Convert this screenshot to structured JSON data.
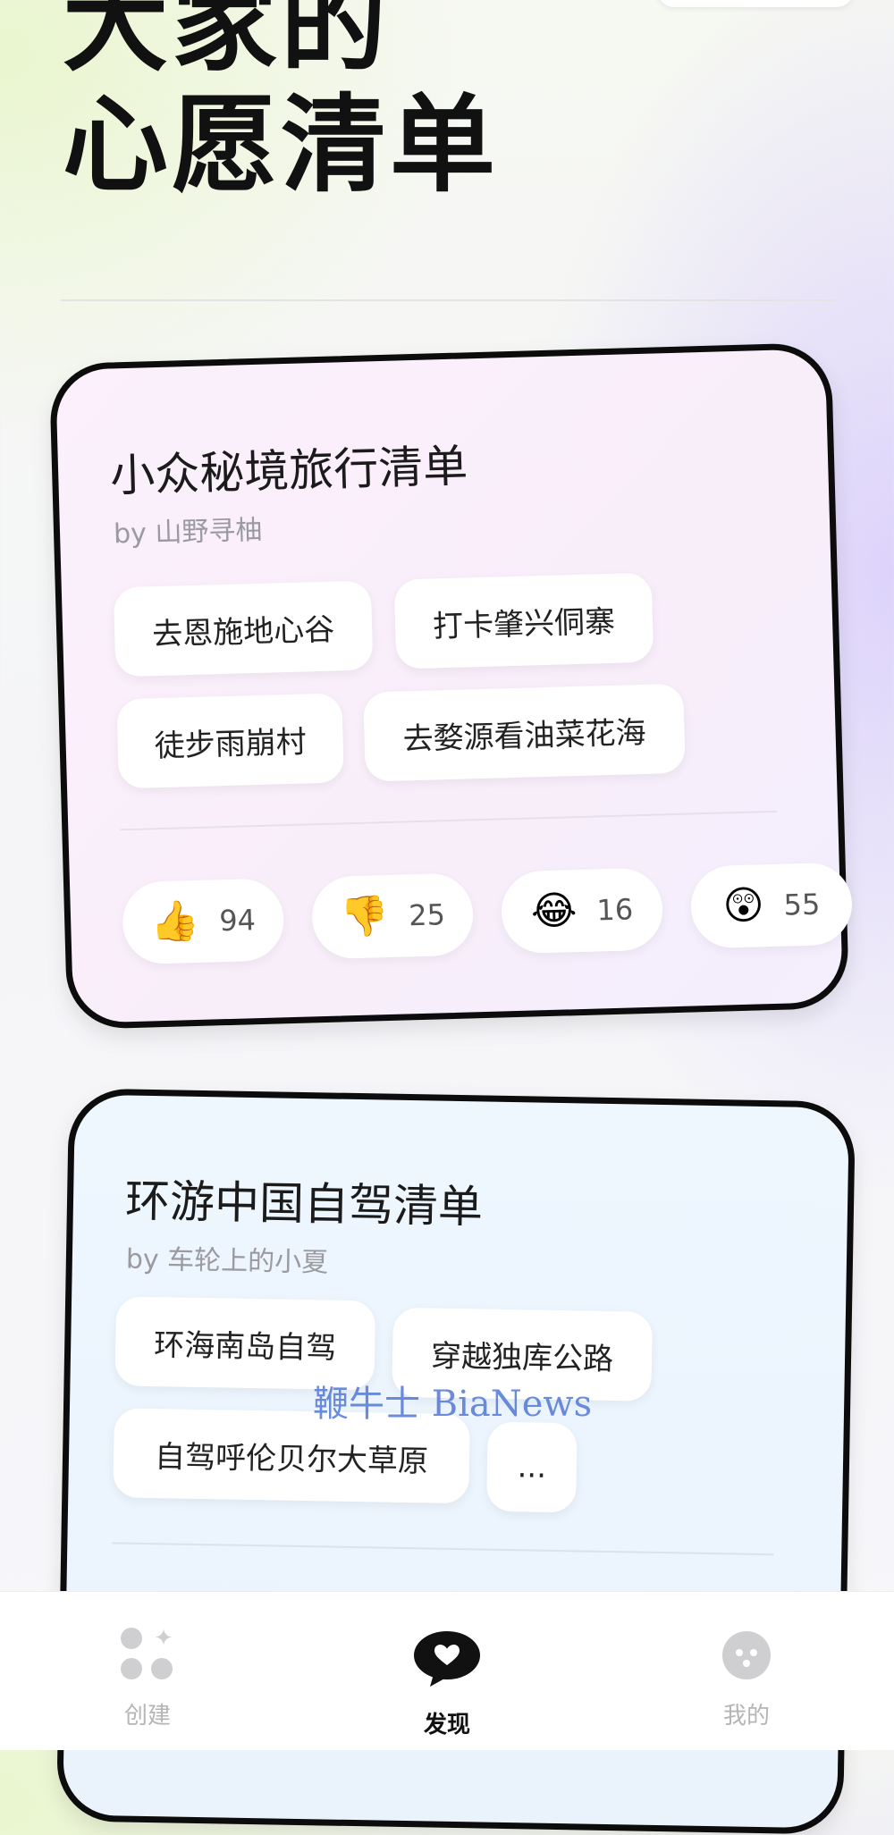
{
  "hero": {
    "line1": "大家的",
    "line2": "心愿清单"
  },
  "cards": [
    {
      "title": "小众秘境旅行清单",
      "author": "by 山野寻柚",
      "tags": [
        "去恩施地心谷",
        "打卡肇兴侗寨",
        "徒步雨崩村",
        "去婺源看油菜花海"
      ],
      "reactions": [
        {
          "icon": "thumbs-up",
          "emoji": "👍",
          "count": "94"
        },
        {
          "icon": "thumbs-down",
          "emoji": "👎",
          "count": "25"
        },
        {
          "icon": "laughing-face",
          "emoji": "😂",
          "count": "16"
        },
        {
          "icon": "surprised-face",
          "emoji": "😲",
          "count": "55"
        }
      ]
    },
    {
      "title": "环游中国自驾清单",
      "author": "by 车轮上的小夏",
      "tags": [
        "环海南岛自驾",
        "穿越独库公路",
        "自驾呼伦贝尔大草原",
        "..."
      ]
    }
  ],
  "watermark": "鞭牛士 BiaNews",
  "nav": [
    {
      "label": "创建",
      "icon": "create-dots-icon",
      "active": false
    },
    {
      "label": "发现",
      "icon": "heart-bubble-icon",
      "active": true
    },
    {
      "label": "我的",
      "icon": "face-icon",
      "active": false
    }
  ],
  "colors": {
    "text": "#111111",
    "card1_bg": "#f8eefa",
    "card2_bg": "#eaf3fc",
    "border": "#0c0c0c",
    "nav_inactive": "#b5b5b8"
  }
}
